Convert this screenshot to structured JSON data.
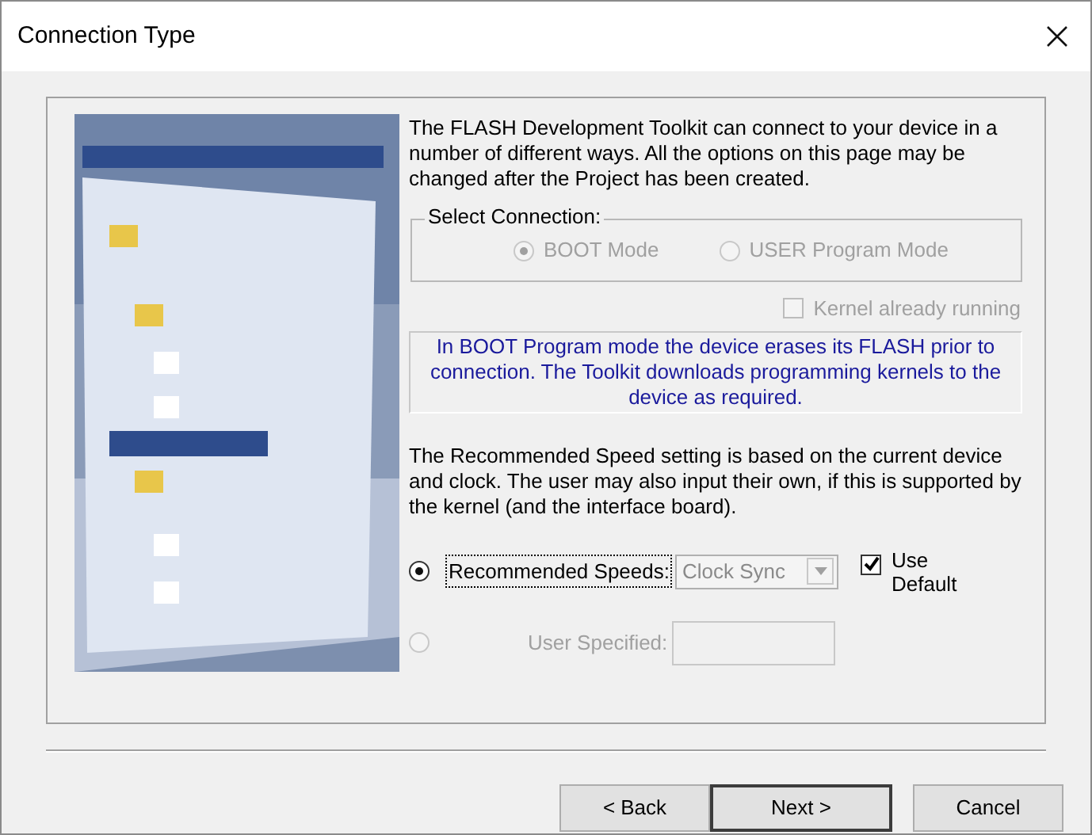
{
  "window": {
    "title": "Connection Type"
  },
  "intro": "The FLASH Development Toolkit can connect to your device in a number of different ways. All the options on this page may be changed after the Project has been created.",
  "connection": {
    "legend": "Select Connection:",
    "disabled": true,
    "modes": [
      {
        "label": "BOOT Mode",
        "selected": true
      },
      {
        "label": "USER Program Mode",
        "selected": false
      }
    ]
  },
  "kernel": {
    "label": "Kernel already running",
    "checked": false,
    "disabled": true
  },
  "info": "In BOOT Program mode the device erases its FLASH prior to connection. The Toolkit downloads programming kernels to the device as required.",
  "speed_text": "The Recommended Speed setting is based on the current device and clock. The user may also input their own, if this is supported by the kernel (and the interface board).",
  "speeds": [
    {
      "kind": "recommended",
      "label": "Recommended Speeds:",
      "selected": true,
      "disabled": false,
      "value": "Clock Sync",
      "use_default": {
        "label": "Use Default",
        "checked": true
      }
    },
    {
      "kind": "custom",
      "label": "User Specified:",
      "selected": false,
      "disabled": true
    }
  ],
  "buttons": [
    {
      "label": "< Back",
      "default": false
    },
    {
      "label": "Next >",
      "default": true
    },
    {
      "label": "Cancel",
      "default": false
    }
  ]
}
